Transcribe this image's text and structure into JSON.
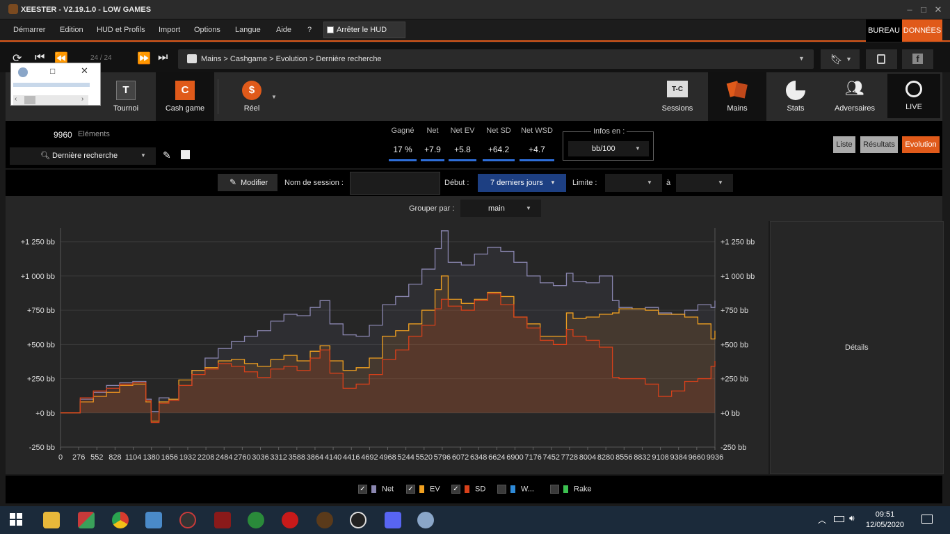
{
  "app": {
    "title": "XEESTER - V2.19.1.0 - LOW GAMES"
  },
  "menu": {
    "items": [
      "Démarrer",
      "Edition",
      "HUD et Profils",
      "Import",
      "Options",
      "Langue",
      "Aide",
      "?"
    ],
    "hud_button": "Arrêter le HUD",
    "bureau": "BUREAU",
    "donnees": "DONNÉES"
  },
  "nav": {
    "page": "24 / 24",
    "breadcrumb": "Mains > Cashgame > Evolution > Dernière recherche"
  },
  "modes": {
    "left": [
      "Tournoi",
      "Cash game",
      "Réel"
    ],
    "right": [
      "Sessions",
      "Mains",
      "Stats",
      "Adversaires",
      "LIVE"
    ],
    "tournoi_letter": "T",
    "cash_letter": "C",
    "reel_symbol": "$",
    "sessions_badge": "T-C"
  },
  "filters": {
    "elements_count": "9960",
    "elements_label": "Eléments",
    "search": "Dernière recherche",
    "stats": [
      {
        "label": "Gagné",
        "value": "17 %"
      },
      {
        "label": "Net",
        "value": "+7.9"
      },
      {
        "label": "Net EV",
        "value": "+5.8"
      },
      {
        "label": "Net SD",
        "value": "+64.2"
      },
      {
        "label": "Net WSD",
        "value": "+4.7"
      }
    ],
    "infos_label": "Infos en :",
    "infos_value": "bb/100",
    "views": [
      "Liste",
      "Résultats",
      "Evolution"
    ]
  },
  "session": {
    "modify": "Modifier",
    "name_label": "Nom de session :",
    "start_label": "Début :",
    "start_value": "7 derniers jours",
    "limit_label": "Limite :",
    "to_label": "à",
    "group_label": "Grouper par :",
    "group_value": "main"
  },
  "details": {
    "label": "Détails"
  },
  "legend": [
    {
      "name": "Net",
      "checked": true,
      "color": "#8a86b0"
    },
    {
      "name": "EV",
      "checked": true,
      "color": "#f0a020"
    },
    {
      "name": "SD",
      "checked": true,
      "color": "#d8401a"
    },
    {
      "name": "W...",
      "checked": false,
      "color": "#2e8ad8"
    },
    {
      "name": "Rake",
      "checked": false,
      "color": "#3cc050"
    }
  ],
  "taskbar": {
    "time": "09:51",
    "date": "12/05/2020"
  },
  "chart_data": {
    "type": "line",
    "x_ticks": [
      0,
      276,
      552,
      828,
      1104,
      1380,
      1656,
      1932,
      2208,
      2484,
      2760,
      3036,
      3312,
      3588,
      3864,
      4140,
      4416,
      4692,
      4968,
      5244,
      5520,
      5796,
      6072,
      6348,
      6624,
      6900,
      7176,
      7452,
      7728,
      8004,
      8280,
      8556,
      8832,
      9108,
      9384,
      9660,
      9936
    ],
    "y_ticks": [
      "+1 250 bb",
      "+1 000 bb",
      "+750 bb",
      "+500 bb",
      "+250 bb",
      "+0 bb",
      "-250 bb"
    ],
    "y_tick_values": [
      1250,
      1000,
      750,
      500,
      250,
      0,
      -250
    ],
    "ylim": [
      -250,
      1350
    ],
    "xlim": [
      0,
      9960
    ],
    "x": [
      0,
      300,
      500,
      700,
      900,
      1100,
      1300,
      1380,
      1500,
      1650,
      1800,
      2000,
      2200,
      2400,
      2600,
      2800,
      3000,
      3200,
      3400,
      3600,
      3800,
      3950,
      4100,
      4300,
      4500,
      4700,
      4900,
      5100,
      5300,
      5500,
      5700,
      5796,
      5900,
      6100,
      6300,
      6500,
      6700,
      6900,
      7100,
      7300,
      7500,
      7700,
      7800,
      8000,
      8200,
      8400,
      8500,
      8700,
      8900,
      9100,
      9300,
      9500,
      9700,
      9900,
      9960
    ],
    "series": [
      {
        "name": "Net",
        "values": [
          0,
          100,
          150,
          200,
          220,
          230,
          100,
          10,
          110,
          100,
          200,
          310,
          400,
          470,
          520,
          560,
          600,
          670,
          720,
          710,
          770,
          820,
          650,
          570,
          560,
          640,
          790,
          850,
          940,
          1050,
          1200,
          1330,
          1100,
          1080,
          1160,
          1210,
          1180,
          1100,
          1000,
          950,
          930,
          1020,
          960,
          950,
          1000,
          820,
          770,
          760,
          770,
          730,
          720,
          750,
          790,
          770,
          820
        ]
      },
      {
        "name": "EV",
        "values": [
          0,
          80,
          120,
          150,
          200,
          210,
          80,
          -60,
          80,
          100,
          240,
          310,
          330,
          380,
          390,
          360,
          340,
          390,
          420,
          380,
          450,
          490,
          380,
          310,
          330,
          400,
          560,
          600,
          650,
          750,
          900,
          1000,
          830,
          800,
          830,
          880,
          850,
          700,
          650,
          560,
          560,
          730,
          690,
          700,
          720,
          730,
          760,
          760,
          750,
          720,
          720,
          700,
          650,
          540,
          600
        ]
      },
      {
        "name": "SD",
        "values": [
          0,
          110,
          160,
          180,
          210,
          220,
          90,
          -70,
          70,
          90,
          200,
          280,
          320,
          360,
          340,
          300,
          260,
          320,
          340,
          310,
          400,
          460,
          290,
          180,
          210,
          280,
          390,
          460,
          560,
          640,
          760,
          830,
          780,
          750,
          820,
          870,
          790,
          700,
          620,
          530,
          500,
          610,
          560,
          530,
          480,
          260,
          250,
          250,
          210,
          120,
          160,
          230,
          250,
          340,
          380
        ]
      }
    ]
  }
}
